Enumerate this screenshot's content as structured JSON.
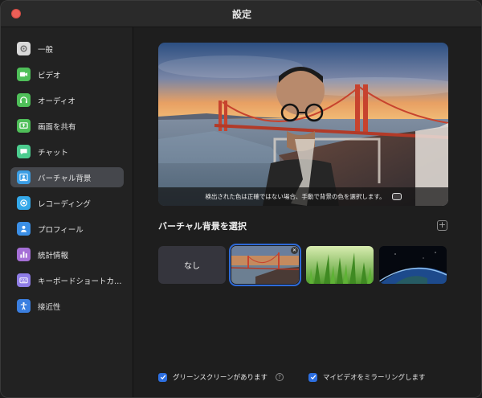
{
  "window": {
    "title": "設定"
  },
  "sidebar": {
    "items": [
      {
        "label": "一般",
        "icon": "gear-icon",
        "color": "#d9d9d9"
      },
      {
        "label": "ビデオ",
        "icon": "video-camera-icon",
        "color": "#4fbf59"
      },
      {
        "label": "オーディオ",
        "icon": "headphones-icon",
        "color": "#4fbf59"
      },
      {
        "label": "画面を共有",
        "icon": "share-screen-icon",
        "color": "#4fbf59"
      },
      {
        "label": "チャット",
        "icon": "chat-bubble-icon",
        "color": "#4ccd8f"
      },
      {
        "label": "バーチャル背景",
        "icon": "person-background-icon",
        "color": "#3b9ee4",
        "active": true
      },
      {
        "label": "レコーディング",
        "icon": "record-icon",
        "color": "#34a8e9"
      },
      {
        "label": "プロフィール",
        "icon": "profile-icon",
        "color": "#3b8fe6"
      },
      {
        "label": "統計情報",
        "icon": "bar-chart-icon",
        "color": "#a56fd6"
      },
      {
        "label": "キーボードショートカ…",
        "icon": "keyboard-icon",
        "color": "#8f7de6"
      },
      {
        "label": "接近性",
        "icon": "accessibility-icon",
        "color": "#3b7fe0"
      }
    ]
  },
  "main": {
    "preview_notice": "検出された色は正確ではない場合、手動で背景の色を選択します。",
    "section_title": "バーチャル背景を選択",
    "backgrounds": [
      {
        "label": "なし"
      },
      {
        "name": "golden-gate-bridge",
        "selected": true
      },
      {
        "name": "grass"
      },
      {
        "name": "earth-from-space"
      }
    ],
    "options": [
      {
        "label": "グリーンスクリーンがあります",
        "checked": true
      },
      {
        "label": "マイビデオをミラーリングします",
        "checked": true
      }
    ]
  }
}
